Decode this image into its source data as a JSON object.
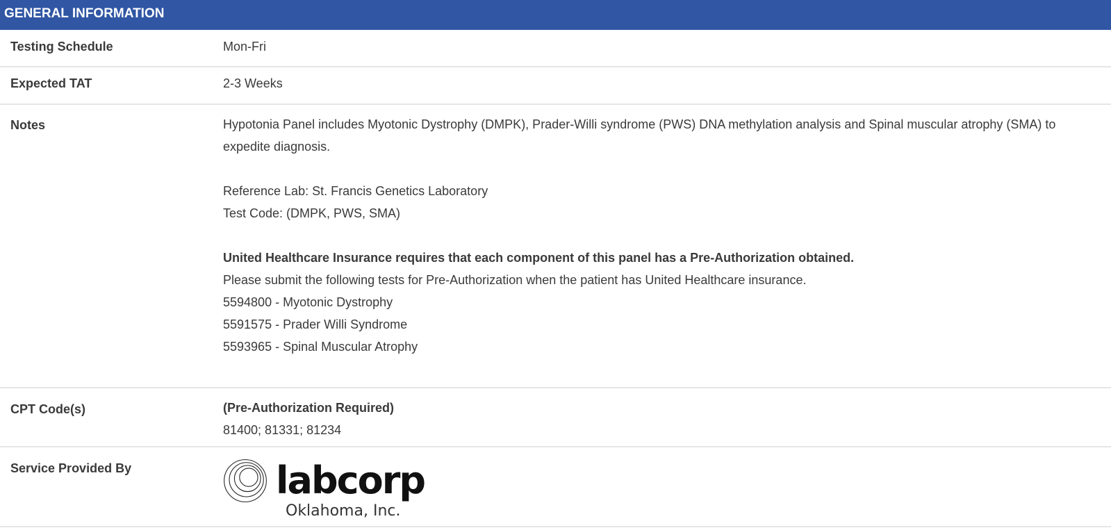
{
  "section": {
    "title": "GENERAL INFORMATION"
  },
  "rows": {
    "schedule": {
      "label": "Testing Schedule",
      "value": "Mon-Fri"
    },
    "tat": {
      "label": "Expected TAT",
      "value": "2-3 Weeks"
    },
    "notes": {
      "label": "Notes",
      "intro": "Hypotonia Panel includes Myotonic Dystrophy (DMPK), Prader-Willi syndrome (PWS) DNA methylation analysis and Spinal muscular atrophy (SMA) to expedite diagnosis.",
      "reference_lab": "Reference Lab: St. Francis Genetics Laboratory",
      "test_code": "Test Code: (DMPK, PWS, SMA)",
      "insurance_warning": "United Healthcare Insurance requires that each component of this panel has a Pre-Authorization obtained.",
      "insurance_instructions": "Please submit the following tests for Pre-Authorization when the patient has United Healthcare insurance.",
      "tests": [
        "5594800 - Myotonic Dystrophy",
        "5591575 - Prader Willi Syndrome",
        "5593965 - Spinal Muscular Atrophy"
      ]
    },
    "cpt": {
      "label": "CPT Code(s)",
      "note": "(Pre-Authorization Required)",
      "codes": "81400; 81331; 81234"
    },
    "provider": {
      "label": "Service Provided By",
      "logo_name": "labcorp",
      "logo_subtitle": "Oklahoma, Inc."
    }
  },
  "colors": {
    "header_bg": "#3056a4",
    "text": "#3a3a3a",
    "divider": "#e6e6e6"
  }
}
